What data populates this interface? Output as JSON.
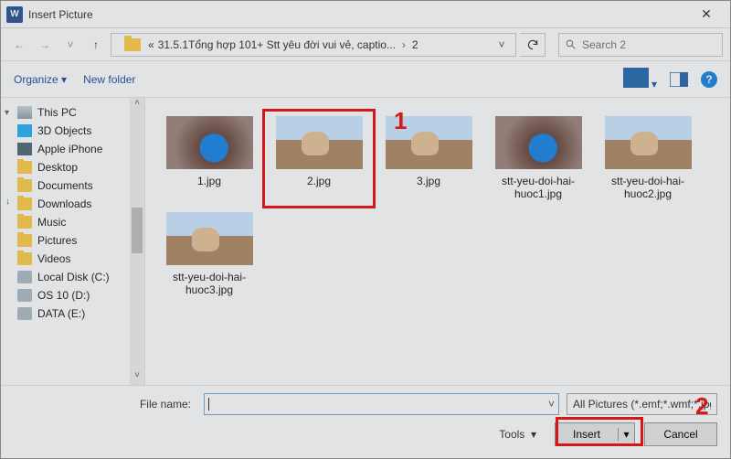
{
  "title": "Insert Picture",
  "nav": {
    "breadcrumb_prefix": "«",
    "breadcrumb_parent": "31.5.1Tổng hợp 101+ Stt yêu đời vui vẻ, captio...",
    "breadcrumb_current": "2",
    "search_placeholder": "Search 2"
  },
  "toolbar": {
    "organize": "Organize",
    "new_folder": "New folder"
  },
  "tree": [
    {
      "icon": "pc",
      "label": "This PC",
      "caret": "▾"
    },
    {
      "icon": "obj",
      "label": "3D Objects"
    },
    {
      "icon": "phone",
      "label": "Apple iPhone"
    },
    {
      "icon": "fold",
      "label": "Desktop"
    },
    {
      "icon": "fold",
      "label": "Documents"
    },
    {
      "icon": "fold dl",
      "label": "Downloads"
    },
    {
      "icon": "fold",
      "label": "Music"
    },
    {
      "icon": "fold",
      "label": "Pictures"
    },
    {
      "icon": "fold",
      "label": "Videos"
    },
    {
      "icon": "disk",
      "label": "Local Disk (C:)"
    },
    {
      "icon": "disk",
      "label": "OS 10 (D:)"
    },
    {
      "icon": "disk",
      "label": "DATA (E:)"
    }
  ],
  "files": [
    {
      "name": "1.jpg",
      "style": "blue",
      "selected": false
    },
    {
      "name": "2.jpg",
      "style": "cat",
      "selected": true
    },
    {
      "name": "3.jpg",
      "style": "cat",
      "selected": false
    },
    {
      "name": "stt-yeu-doi-hai-huoc1.jpg",
      "style": "blue",
      "selected": false
    },
    {
      "name": "stt-yeu-doi-hai-huoc2.jpg",
      "style": "cat",
      "selected": false
    },
    {
      "name": "stt-yeu-doi-hai-huoc3.jpg",
      "style": "cat",
      "selected": false
    }
  ],
  "footer": {
    "file_name_label": "File name:",
    "file_name_value": "",
    "filter": "All Pictures (*.emf;*.wmf;*.jpg;*.j",
    "tools": "Tools",
    "insert": "Insert",
    "cancel": "Cancel"
  },
  "annotations": {
    "a1": "1",
    "a2": "2"
  },
  "icons": {
    "app": "W",
    "help": "?"
  }
}
